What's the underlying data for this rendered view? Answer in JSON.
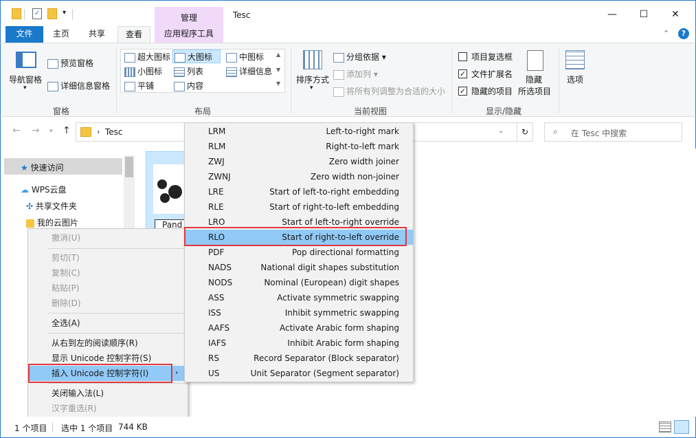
{
  "window": {
    "title": "Tesc",
    "manage_tab": "管理",
    "minimize_glyph": "—",
    "maximize_glyph": "☐",
    "close_glyph": "✕"
  },
  "tabs": [
    "文件",
    "主页",
    "共享",
    "查看",
    "应用程序工具"
  ],
  "ribbon": {
    "panes": {
      "nav_pane": "导航窗格",
      "preview_pane": "预览窗格",
      "details_pane": "详细信息窗格",
      "label": "窗格"
    },
    "layout": {
      "items": [
        "超大图标",
        "大图标",
        "中图标",
        "小图标",
        "列表",
        "详细信息",
        "平铺",
        "内容"
      ],
      "label": "布局"
    },
    "current_view": {
      "sort": "排序方式",
      "group_by": "分组依据",
      "add_column": "添加列",
      "fit_columns": "将所有列调整为合适的大小",
      "label": "当前视图"
    },
    "show_hide": {
      "item_checkbox": "项目复选框",
      "file_ext": "文件扩展名",
      "hidden_items": "隐藏的项目",
      "hide_selected_line1": "隐藏",
      "hide_selected_line2": "所选项目",
      "label": "显示/隐藏"
    },
    "options": "选项"
  },
  "address": {
    "path": "Tesc",
    "search_placeholder": "在 Tesc 中搜索"
  },
  "sidebar": {
    "quick_access": "快速访问",
    "wps_cloud": "WPS云盘",
    "shared_folder": "共享文件夹",
    "my_cloud_pics": "我的云图片"
  },
  "file": {
    "name": "Pand"
  },
  "context_menu": [
    {
      "label": "撤消(U)",
      "disabled": true
    },
    {
      "label": "剪切(T)",
      "disabled": true
    },
    {
      "label": "复制(C)",
      "disabled": true
    },
    {
      "label": "粘贴(P)",
      "disabled": true
    },
    {
      "label": "删除(D)",
      "disabled": true
    },
    {
      "label": "全选(A)",
      "disabled": false
    },
    {
      "label": "从右到左的阅读顺序(R)",
      "disabled": false
    },
    {
      "label": "显示 Unicode 控制字符(S)",
      "disabled": false
    },
    {
      "label": "插入 Unicode 控制字符(I)",
      "disabled": false
    },
    {
      "label": "关闭输入法(L)",
      "disabled": false
    },
    {
      "label": "汉字重选(R)",
      "disabled": true
    }
  ],
  "submenu": [
    {
      "code": "LRM",
      "desc": "Left-to-right mark"
    },
    {
      "code": "RLM",
      "desc": "Right-to-left mark"
    },
    {
      "code": "ZWJ",
      "desc": "Zero width joiner"
    },
    {
      "code": "ZWNJ",
      "desc": "Zero width non-joiner"
    },
    {
      "code": "LRE",
      "desc": "Start of left-to-right embedding"
    },
    {
      "code": "RLE",
      "desc": "Start of right-to-left embedding"
    },
    {
      "code": "LRO",
      "desc": "Start of left-to-right override"
    },
    {
      "code": "RLO",
      "desc": "Start of right-to-left override"
    },
    {
      "code": "PDF",
      "desc": "Pop directional formatting"
    },
    {
      "code": "NADS",
      "desc": "National digit shapes substitution"
    },
    {
      "code": "NODS",
      "desc": "Nominal (European) digit shapes"
    },
    {
      "code": "ASS",
      "desc": "Activate symmetric swapping"
    },
    {
      "code": "ISS",
      "desc": "Inhibit symmetric swapping"
    },
    {
      "code": "AAFS",
      "desc": "Activate Arabic form shaping"
    },
    {
      "code": "IAFS",
      "desc": "Inhibit Arabic form shaping"
    },
    {
      "code": "RS",
      "desc": "Record Separator (Block separator)"
    },
    {
      "code": "US",
      "desc": "Unit Separator (Segment separator)"
    }
  ],
  "status": {
    "item_count": "1 个项目",
    "selected": "选中 1 个项目",
    "size": "744 KB"
  },
  "colors": {
    "accent": "#1979ca",
    "highlight": "#91c9f7",
    "manage": "#f1d9fa",
    "red_outline": "#e0383e"
  }
}
